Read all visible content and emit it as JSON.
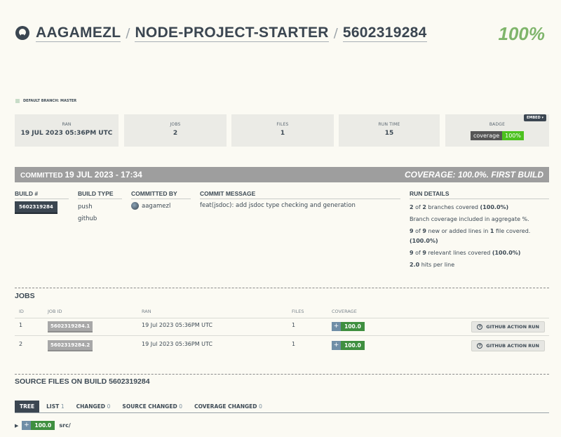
{
  "header": {
    "owner": "AAGAMEZL",
    "repo": "NODE-PROJECT-STARTER",
    "build": "5602319284",
    "coverage": "100%",
    "separator": "/"
  },
  "branch": {
    "label": "DEFAULT BRANCH: MASTER"
  },
  "stats": {
    "ran": {
      "label": "RAN",
      "value": "19 JUL 2023 05:36PM UTC"
    },
    "jobs": {
      "label": "JOBS",
      "value": "2"
    },
    "files": {
      "label": "FILES",
      "value": "1"
    },
    "run_time": {
      "label": "RUN TIME",
      "value": "15"
    },
    "badge": {
      "label": "BADGE",
      "left": "coverage",
      "right": "100%",
      "embed": "EMBED ▾"
    }
  },
  "commit_bar": {
    "prefix": "COMMITTED",
    "date": "19 JUL 2023 - 17:34",
    "summary": "COVERAGE: 100.0%. FIRST BUILD"
  },
  "details": {
    "headers": {
      "build": "BUILD #",
      "type": "BUILD TYPE",
      "by": "COMMITTED BY",
      "message": "COMMIT MESSAGE",
      "run": "RUN DETAILS"
    },
    "build_number": "5602319284",
    "build_types": [
      "push",
      "github"
    ],
    "committer": "aagamezl",
    "message": "feat(jsdoc): add jsdoc type checking and generation",
    "run_lines": {
      "l1a": "2",
      "l1b": " of ",
      "l1c": "2",
      "l1d": " branches covered ",
      "l1e": "(100.0%)",
      "l2": "Branch coverage included in aggregate %.",
      "l3a": "9",
      "l3b": " of ",
      "l3c": "9",
      "l3d": " new or added lines in ",
      "l3e": "1",
      "l3f": " file covered.",
      "l3g": "(100.0%)",
      "l4a": "9",
      "l4b": " of ",
      "l4c": "9",
      "l4d": " relevant lines covered ",
      "l4e": "(100.0%)",
      "l5a": "2.0",
      "l5b": " hits per line"
    }
  },
  "jobs": {
    "title": "JOBS",
    "headers": {
      "id": "ID",
      "job_id": "JOB ID",
      "ran": "RAN",
      "files": "FILES",
      "coverage": "COVERAGE"
    },
    "rows": [
      {
        "id": "1",
        "job_id": "5602319284.1",
        "ran": "19 Jul 2023 05:36PM UTC",
        "files": "1",
        "coverage": "100.0",
        "action": "GITHUB ACTION RUN"
      },
      {
        "id": "2",
        "job_id": "5602319284.2",
        "ran": "19 Jul 2023 05:36PM UTC",
        "files": "1",
        "coverage": "100.0",
        "action": "GITHUB ACTION RUN"
      }
    ]
  },
  "source": {
    "title": "SOURCE FILES ON BUILD 5602319284",
    "tabs": [
      {
        "label": "TREE",
        "count": ""
      },
      {
        "label": "LIST",
        "count": "1"
      },
      {
        "label": "CHANGED",
        "count": "0"
      },
      {
        "label": "SOURCE CHANGED",
        "count": "0"
      },
      {
        "label": "COVERAGE CHANGED",
        "count": "0"
      }
    ],
    "tree_row": {
      "coverage": "100.0",
      "path": "src/"
    }
  },
  "colors": {
    "accent": "#3b4651",
    "coverage_green": "#7fb56b",
    "badge_green": "#4cc11f",
    "bar_green": "#3f8f3f"
  }
}
